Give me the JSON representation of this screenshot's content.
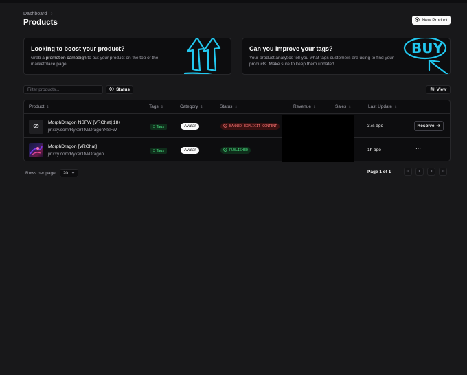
{
  "breadcrumb": {
    "item": "Dashboard",
    "separator": "›"
  },
  "page": {
    "title": "Products",
    "new_button": "New Product"
  },
  "banners": [
    {
      "title": "Looking to boost your product?",
      "text_before": "Grab a ",
      "link": "promotion campaign",
      "text_after": " to put your product on the top of the marketplace page."
    },
    {
      "title": "Can you improve your tags?",
      "text": "Your product analytics tell you what tags customers are using to find your products. Make sure to keep them updated.",
      "art_text": "BUY"
    }
  ],
  "toolbar": {
    "filter_placeholder": "Filter products...",
    "status_label": "Status",
    "view_label": "View"
  },
  "table": {
    "columns": [
      "Product",
      "Tags",
      "Category",
      "Status",
      "Revenue",
      "Sales",
      "Last Update"
    ],
    "rows": [
      {
        "name": "MorphDragon NSFW [VRChat] 18+",
        "url": "jinxxy.com/RykerTM/DragonNSFW",
        "tags": "3 Tags",
        "category": "Avatar",
        "status": "BANNED_EXPLICIT_CONTENT",
        "last_update": "37s ago",
        "action": "Resolve"
      },
      {
        "name": "MorphDragon [VRChat]",
        "url": "jinxxy.com/RykerTM/Dragon",
        "tags": "3 Tags",
        "category": "Avatar",
        "status": "PUBLISHED",
        "last_update": "1h ago",
        "action": "···"
      }
    ]
  },
  "pagination": {
    "rows_per_page_label": "Rows per page",
    "rows_per_page": "20",
    "page_info": "Page 1 of 1"
  },
  "colors": {
    "background": "#18181a",
    "card": "#0d0d0f",
    "accent_art": "#22c8f0",
    "banned": "#f87171",
    "published": "#4ade80"
  },
  "icons": [
    "chevron-right-icon",
    "plus-circle-icon",
    "plus-circle-icon",
    "sliders-icon",
    "sort-icon",
    "eye-off-icon",
    "alert-circle-icon",
    "check-circle-icon",
    "arrow-right-icon",
    "chevron-down-icon",
    "chevrons-left-icon",
    "chevron-left-icon",
    "chevron-right-icon",
    "chevrons-right-icon"
  ]
}
